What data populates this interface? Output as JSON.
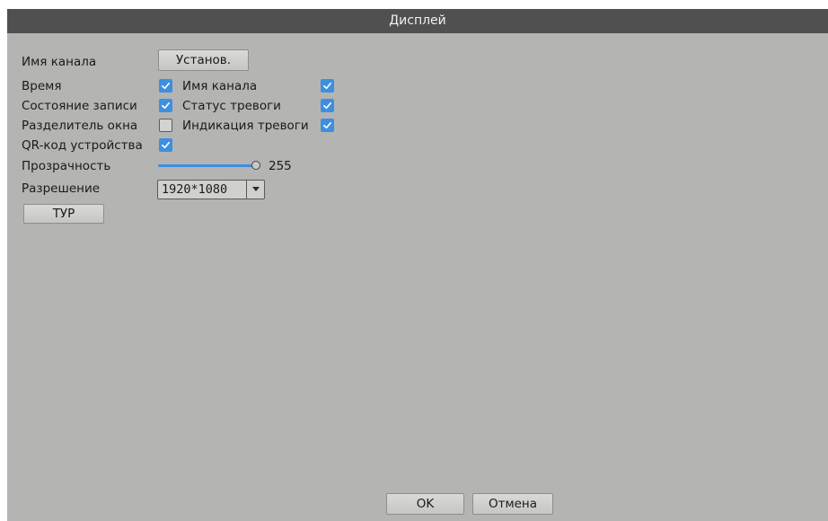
{
  "window": {
    "title": "Дисплей"
  },
  "rows": {
    "channel_name_label": "Имя канала",
    "channel_name_button": "Установ.",
    "time_label": "Время",
    "time_checked": true,
    "channel_name2_label": "Имя канала",
    "channel_name2_checked": true,
    "record_status_label": "Состояние записи",
    "record_status_checked": true,
    "alarm_status_label": "Статус тревоги",
    "alarm_status_checked": true,
    "window_divider_label": "Разделитель окна",
    "window_divider_checked": false,
    "alarm_indication_label": "Индикация тревоги",
    "alarm_indication_checked": true,
    "qr_label": "QR-код устройства",
    "qr_checked": true,
    "transparency_label": "Прозрачность",
    "transparency_value": "255",
    "transparency_fraction": 1.0,
    "resolution_label": "Разрешение",
    "resolution_value": "1920*1080",
    "tour_button": "ТУР"
  },
  "footer": {
    "ok_label": "OK",
    "cancel_label": "Отмена"
  },
  "colors": {
    "accent": "#3d8fe0",
    "background": "#b4b4b2",
    "titlebar": "#505050"
  },
  "icons": {
    "check": "check-icon",
    "dropdown": "chevron-down-icon",
    "slider": "slider-knob"
  }
}
